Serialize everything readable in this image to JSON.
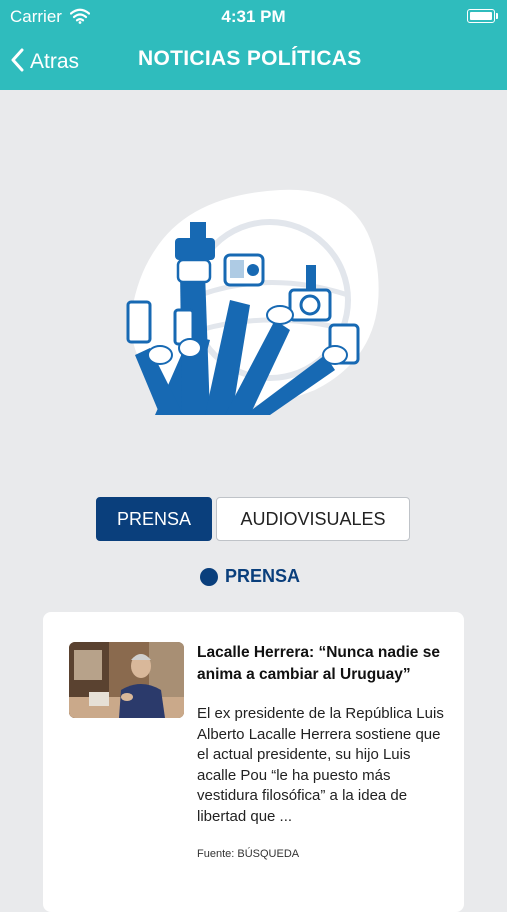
{
  "status_bar": {
    "carrier": "Carrier",
    "time": "4:31 PM"
  },
  "nav": {
    "back_label": "Atras",
    "title": "NOTICIAS POLÍTICAS"
  },
  "tabs": [
    {
      "label": "PRENSA",
      "selected": true
    },
    {
      "label": "AUDIOVISUALES",
      "selected": false
    }
  ],
  "section": {
    "label": "PRENSA"
  },
  "articles": [
    {
      "title": "Lacalle Herrera: “Nunca nadie se anima a cambiar al Uruguay”",
      "body": "El ex presidente de la República Luis Alberto Lacalle Herrera sostiene que el actual presidente, su hijo Luis acalle Pou “le ha puesto más vestidura filosófica” a la idea de libertad que ...",
      "source": "Fuente: BÚSQUEDA"
    }
  ],
  "colors": {
    "header": "#2fbcbd",
    "primary": "#0a3f7c",
    "background": "#e9eaec"
  }
}
